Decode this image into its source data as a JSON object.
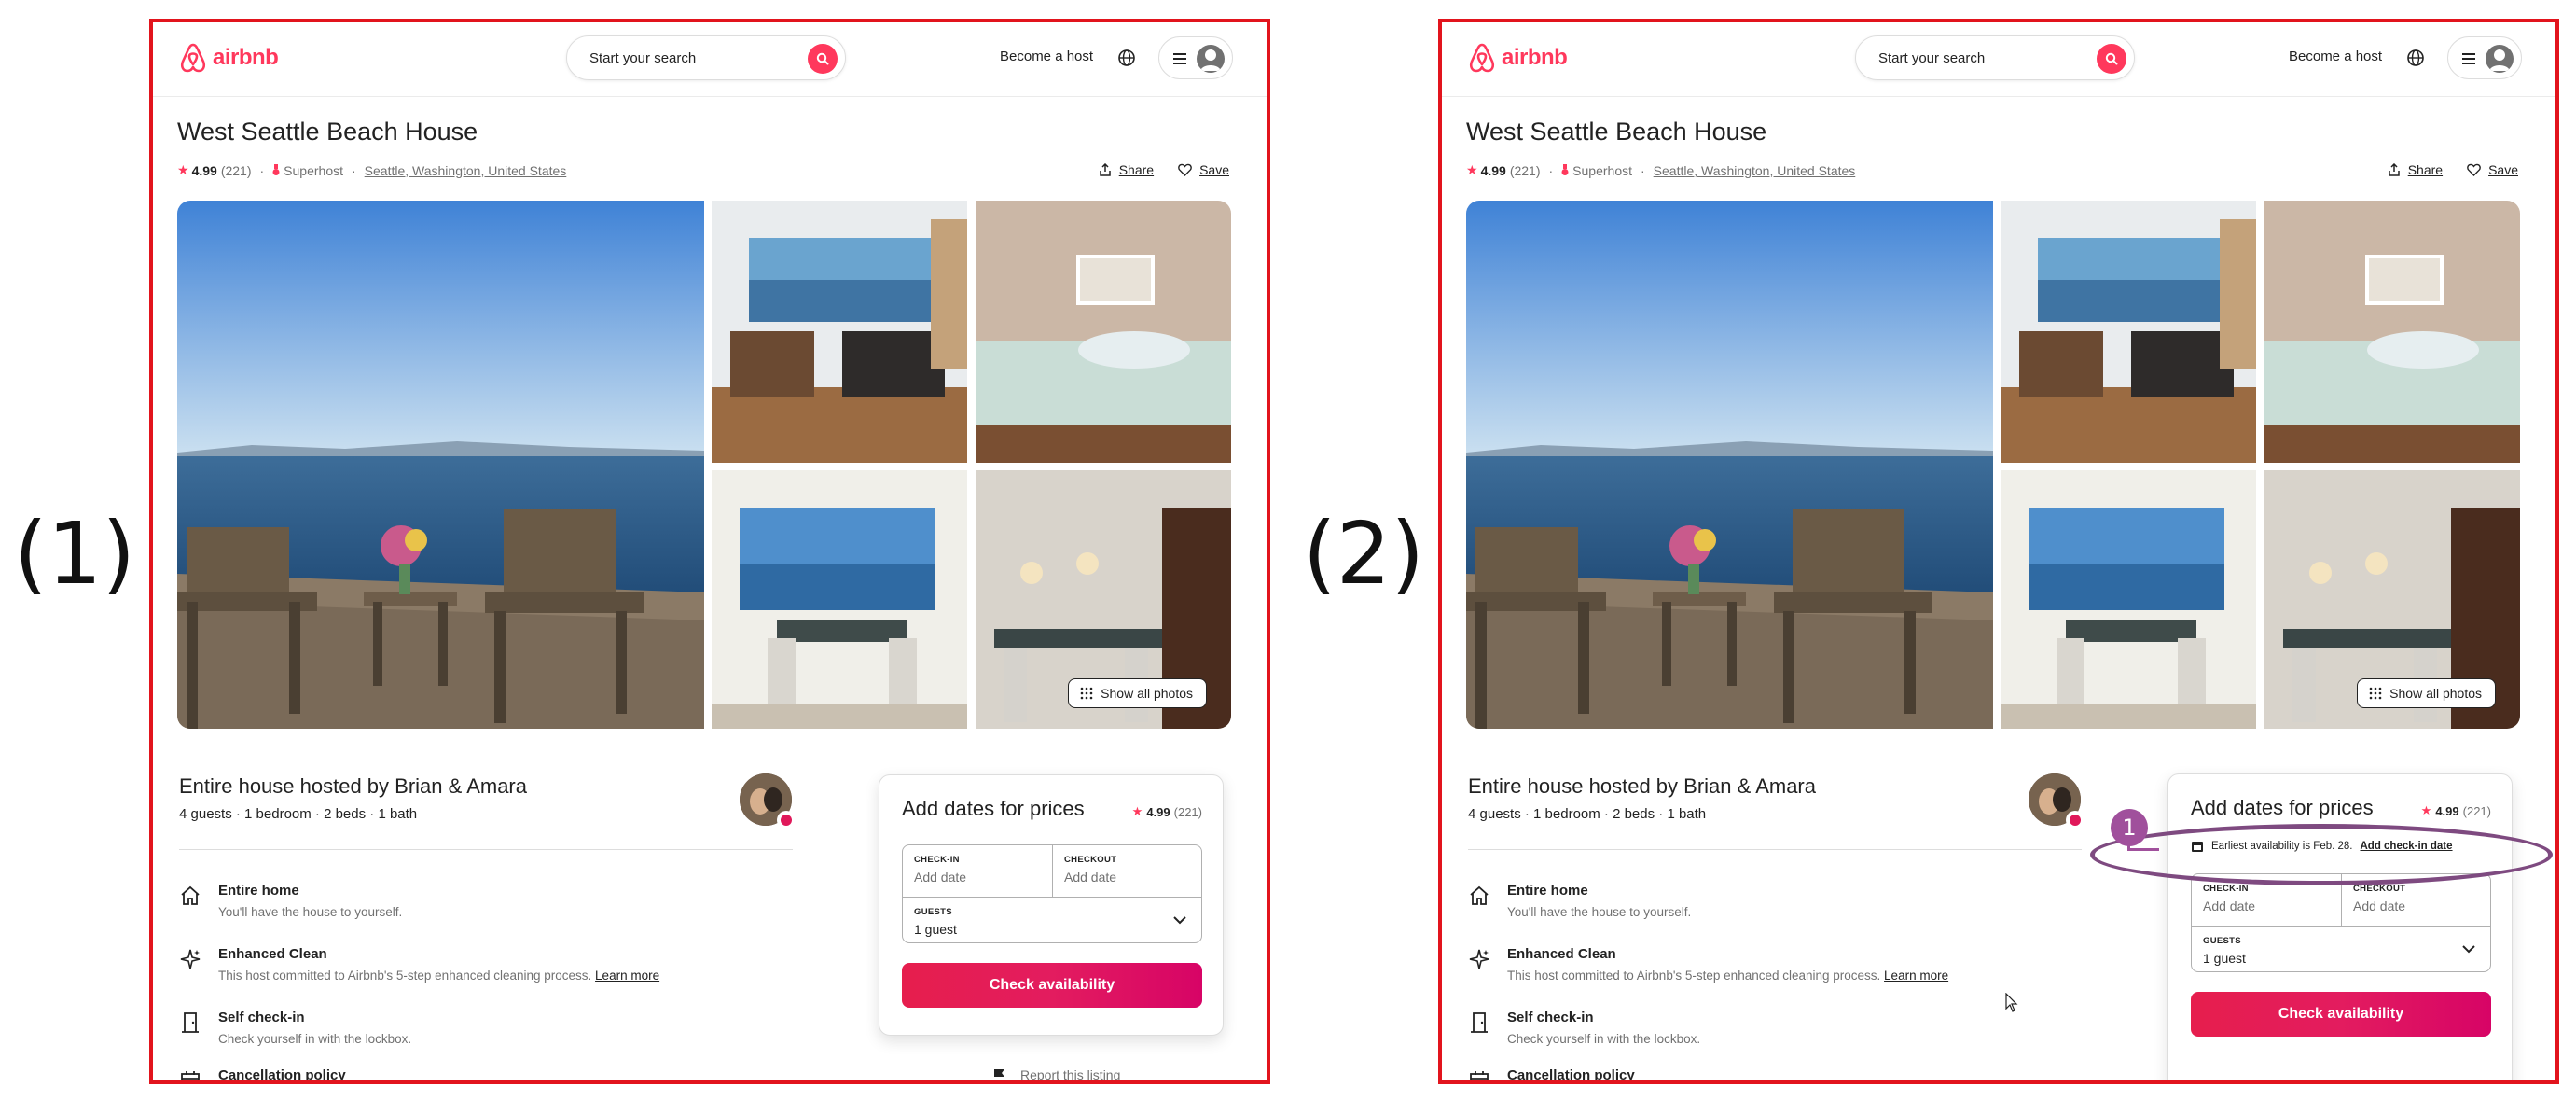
{
  "labels": [
    "(1)",
    "(2)"
  ],
  "colors": {
    "brand": "#ff385c",
    "annotation": "#7e4a80",
    "frame": "#e2141d"
  },
  "header": {
    "logo": "airbnb",
    "search_placeholder": "Start your search",
    "become_host": "Become a host",
    "icons": [
      "airbnb-logo-icon",
      "search-icon",
      "globe-icon",
      "hamburger-icon",
      "user-icon"
    ]
  },
  "listing": {
    "title": "West Seattle Beach House",
    "rating": "4.99",
    "reviews": "(221)",
    "superhost": "Superhost",
    "location": "Seattle, Washington, United States",
    "share": "Share",
    "save": "Save"
  },
  "gallery": {
    "show_all": "Show all photos"
  },
  "host": {
    "title": "Entire house hosted by Brian & Amara",
    "subtitle": "4 guests · 1 bedroom · 2 beds · 1 bath"
  },
  "features": [
    {
      "name": "Entire home",
      "desc": "You'll have the house to yourself.",
      "link": ""
    },
    {
      "name": "Enhanced Clean",
      "desc": "This host committed to Airbnb's 5-step enhanced cleaning process. ",
      "link": "Learn more"
    },
    {
      "name": "Self check-in",
      "desc": "Check yourself in with the lockbox.",
      "link": ""
    },
    {
      "name": "Cancellation policy",
      "desc": "",
      "link": ""
    }
  ],
  "booking": {
    "title": "Add dates for prices",
    "rating": "4.99",
    "reviews": "(221)",
    "checkin_label": "CHECK-IN",
    "checkout_label": "CHECKOUT",
    "date_placeholder": "Add date",
    "guests_label": "GUESTS",
    "guests_value": "1 guest",
    "button": "Check availability",
    "availability_text": "Earliest availability is Feb. 28.",
    "availability_link": "Add check-in date",
    "report": "Report this listing"
  },
  "annotation": {
    "badge": "1"
  }
}
